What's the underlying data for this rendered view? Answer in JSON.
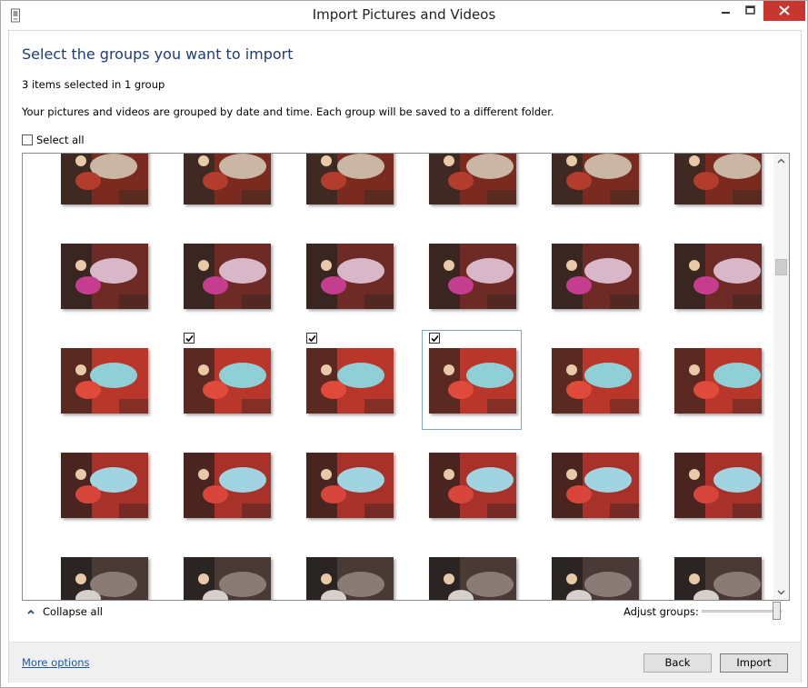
{
  "window": {
    "title": "Import Pictures and Videos"
  },
  "heading": "Select the groups you want to import",
  "summary": "3 items selected in 1 group",
  "description": "Your pictures and videos are grouped by date and time. Each group will be saved to a different folder.",
  "select_all": {
    "label": "Select all",
    "checked": false
  },
  "collapse_all": {
    "label": "Collapse all",
    "icon": "chevron-up-icon"
  },
  "adjust_groups": {
    "label": "Adjust groups:",
    "level": 1.0
  },
  "footer": {
    "more_options": "More options",
    "back": "Back",
    "import": "Import"
  },
  "colors": {
    "heading": "#1e3c78",
    "link": "#1a56b0",
    "close": "#c7372f",
    "focus_border": "#7fa6c9"
  },
  "thumbnails": {
    "rows": [
      {
        "selected": [
          false,
          false,
          false,
          false,
          false,
          false
        ]
      },
      {
        "selected": [
          false,
          false,
          false,
          false,
          false,
          false
        ]
      },
      {
        "selected": [
          false,
          true,
          true,
          true,
          false,
          false
        ]
      },
      {
        "selected": [
          false,
          false,
          false,
          false,
          false,
          false
        ]
      },
      {
        "selected": [
          false,
          false,
          false,
          false,
          false,
          false
        ]
      }
    ],
    "focused": [
      2,
      3
    ]
  }
}
